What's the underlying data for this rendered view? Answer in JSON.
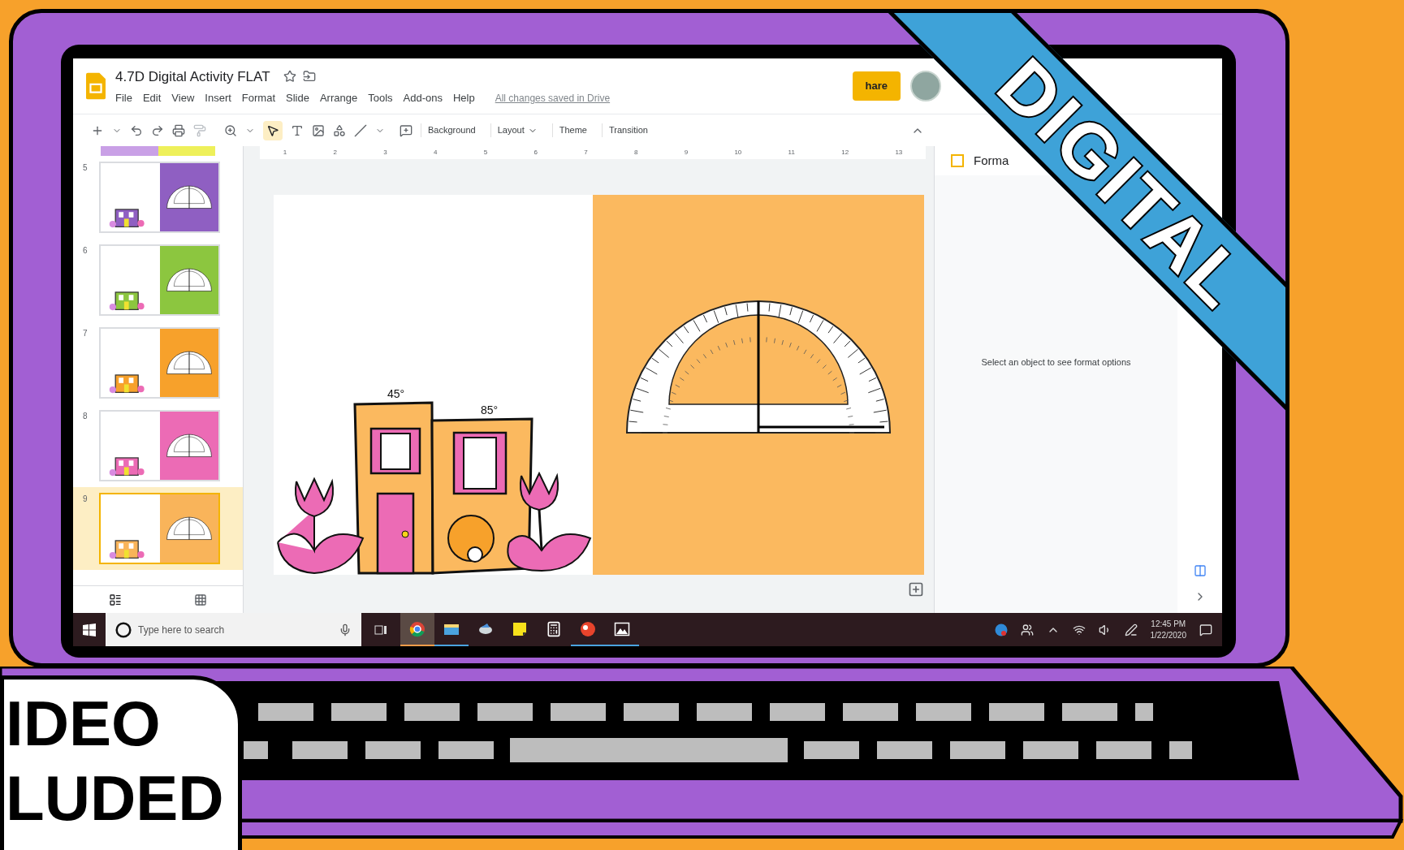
{
  "document": {
    "title": "4.7D Digital Activity FLAT",
    "save_status": "All changes saved in Drive"
  },
  "menu": [
    "File",
    "Edit",
    "View",
    "Insert",
    "Format",
    "Slide",
    "Arrange",
    "Tools",
    "Add-ons",
    "Help"
  ],
  "share_button": {
    "label": "hare"
  },
  "toolbar": {
    "buttons": [
      {
        "label": "Background",
        "kind": "plain"
      },
      {
        "label": "Layout",
        "kind": "dropdown"
      },
      {
        "label": "Theme",
        "kind": "plain"
      },
      {
        "label": "Transition",
        "kind": "plain"
      }
    ]
  },
  "ruler": {
    "marks": [
      "1",
      "2",
      "3",
      "4",
      "5",
      "6",
      "7",
      "8",
      "9",
      "10",
      "11",
      "12",
      "13"
    ]
  },
  "filmstrip": {
    "slides": [
      {
        "number": "5",
        "color": "#8f5fc2",
        "selected": false
      },
      {
        "number": "6",
        "color": "#8cc63f",
        "selected": false
      },
      {
        "number": "7",
        "color": "#f7a12b",
        "selected": false
      },
      {
        "number": "8",
        "color": "#ec6bb5",
        "selected": false
      },
      {
        "number": "9",
        "color": "#f9b45a",
        "selected": true
      }
    ]
  },
  "slide": {
    "angle_labels": [
      "45°",
      "85°"
    ]
  },
  "format_panel": {
    "title": "Forma",
    "message": "Select an object to see format options"
  },
  "taskbar": {
    "search_placeholder": "Type here to search",
    "time": "12:45 PM",
    "date": "1/22/2020",
    "apps": [
      {
        "kind": "chrome",
        "selected": true,
        "running": true
      },
      {
        "kind": "folder",
        "selected": false,
        "running": true
      },
      {
        "kind": "bird",
        "selected": false,
        "running": false
      },
      {
        "kind": "note",
        "selected": false,
        "running": false
      },
      {
        "kind": "calculator",
        "selected": false,
        "running": false
      },
      {
        "kind": "ball",
        "selected": false,
        "running": true
      },
      {
        "kind": "picture",
        "selected": false,
        "running": true
      }
    ]
  },
  "banner": {
    "label": "DIGITAL"
  },
  "badge": {
    "lines": [
      "IDEO",
      "LUDED"
    ]
  }
}
